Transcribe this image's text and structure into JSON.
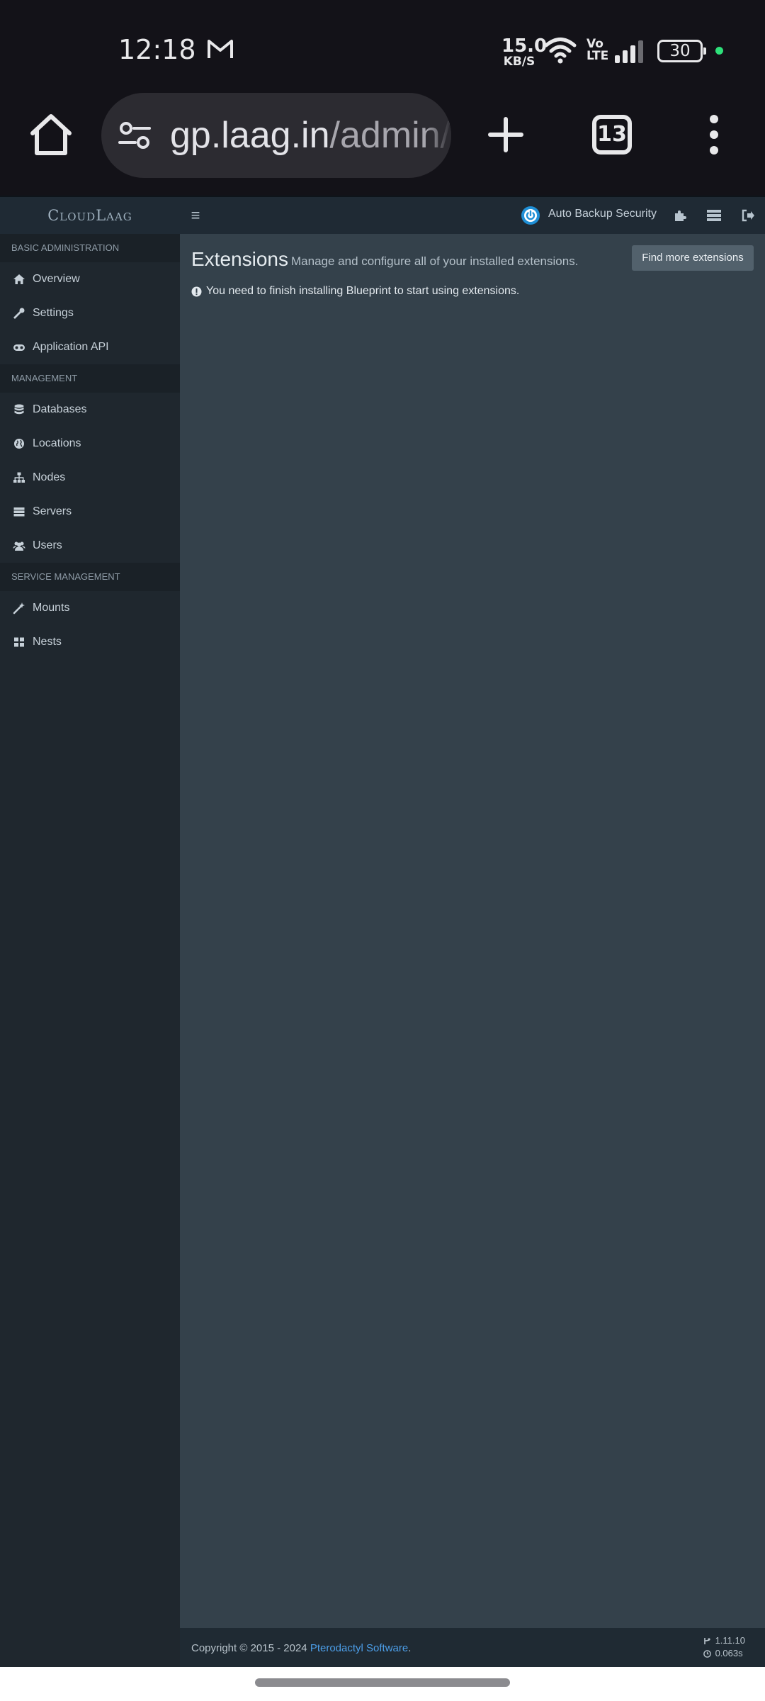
{
  "status_bar": {
    "time": "12:18",
    "net_speed_value": "15.0",
    "net_speed_unit": "KB/S",
    "volte_top": "Vo",
    "volte_bottom": "LTE",
    "battery": "30"
  },
  "browser": {
    "url_host": "gp.laag.in",
    "url_path": "/admin/(",
    "tab_count": "13"
  },
  "panel_header": {
    "brand": "CloudLaag",
    "auto_backup_label": "Auto Backup Security"
  },
  "sidebar": {
    "sections": [
      {
        "title": "BASIC ADMINISTRATION",
        "items": [
          {
            "label": "Overview",
            "icon": "home-icon"
          },
          {
            "label": "Settings",
            "icon": "wrench-icon"
          },
          {
            "label": "Application API",
            "icon": "gamepad-icon"
          }
        ]
      },
      {
        "title": "MANAGEMENT",
        "items": [
          {
            "label": "Databases",
            "icon": "database-icon"
          },
          {
            "label": "Locations",
            "icon": "globe-icon"
          },
          {
            "label": "Nodes",
            "icon": "sitemap-icon"
          },
          {
            "label": "Servers",
            "icon": "server-icon"
          },
          {
            "label": "Users",
            "icon": "users-icon"
          }
        ]
      },
      {
        "title": "SERVICE MANAGEMENT",
        "items": [
          {
            "label": "Mounts",
            "icon": "magic-wand-icon"
          },
          {
            "label": "Nests",
            "icon": "grid-icon"
          }
        ]
      }
    ]
  },
  "main": {
    "title": "Extensions",
    "subtitle": "Manage and configure all of your installed extensions.",
    "find_button": "Find more extensions",
    "notice": "You need to finish installing Blueprint to start using extensions."
  },
  "footer": {
    "copyright": "Copyright © 2015 - 2024 ",
    "link": "Pterodactyl Software",
    "link_suffix": ".",
    "version": "1.11.10",
    "time": "0.063s"
  },
  "colors": {
    "accent_link": "#4c9ee8",
    "content_bg": "#34414b",
    "sidebar_bg": "#1f272e",
    "status_dot": "#2ee07a"
  }
}
